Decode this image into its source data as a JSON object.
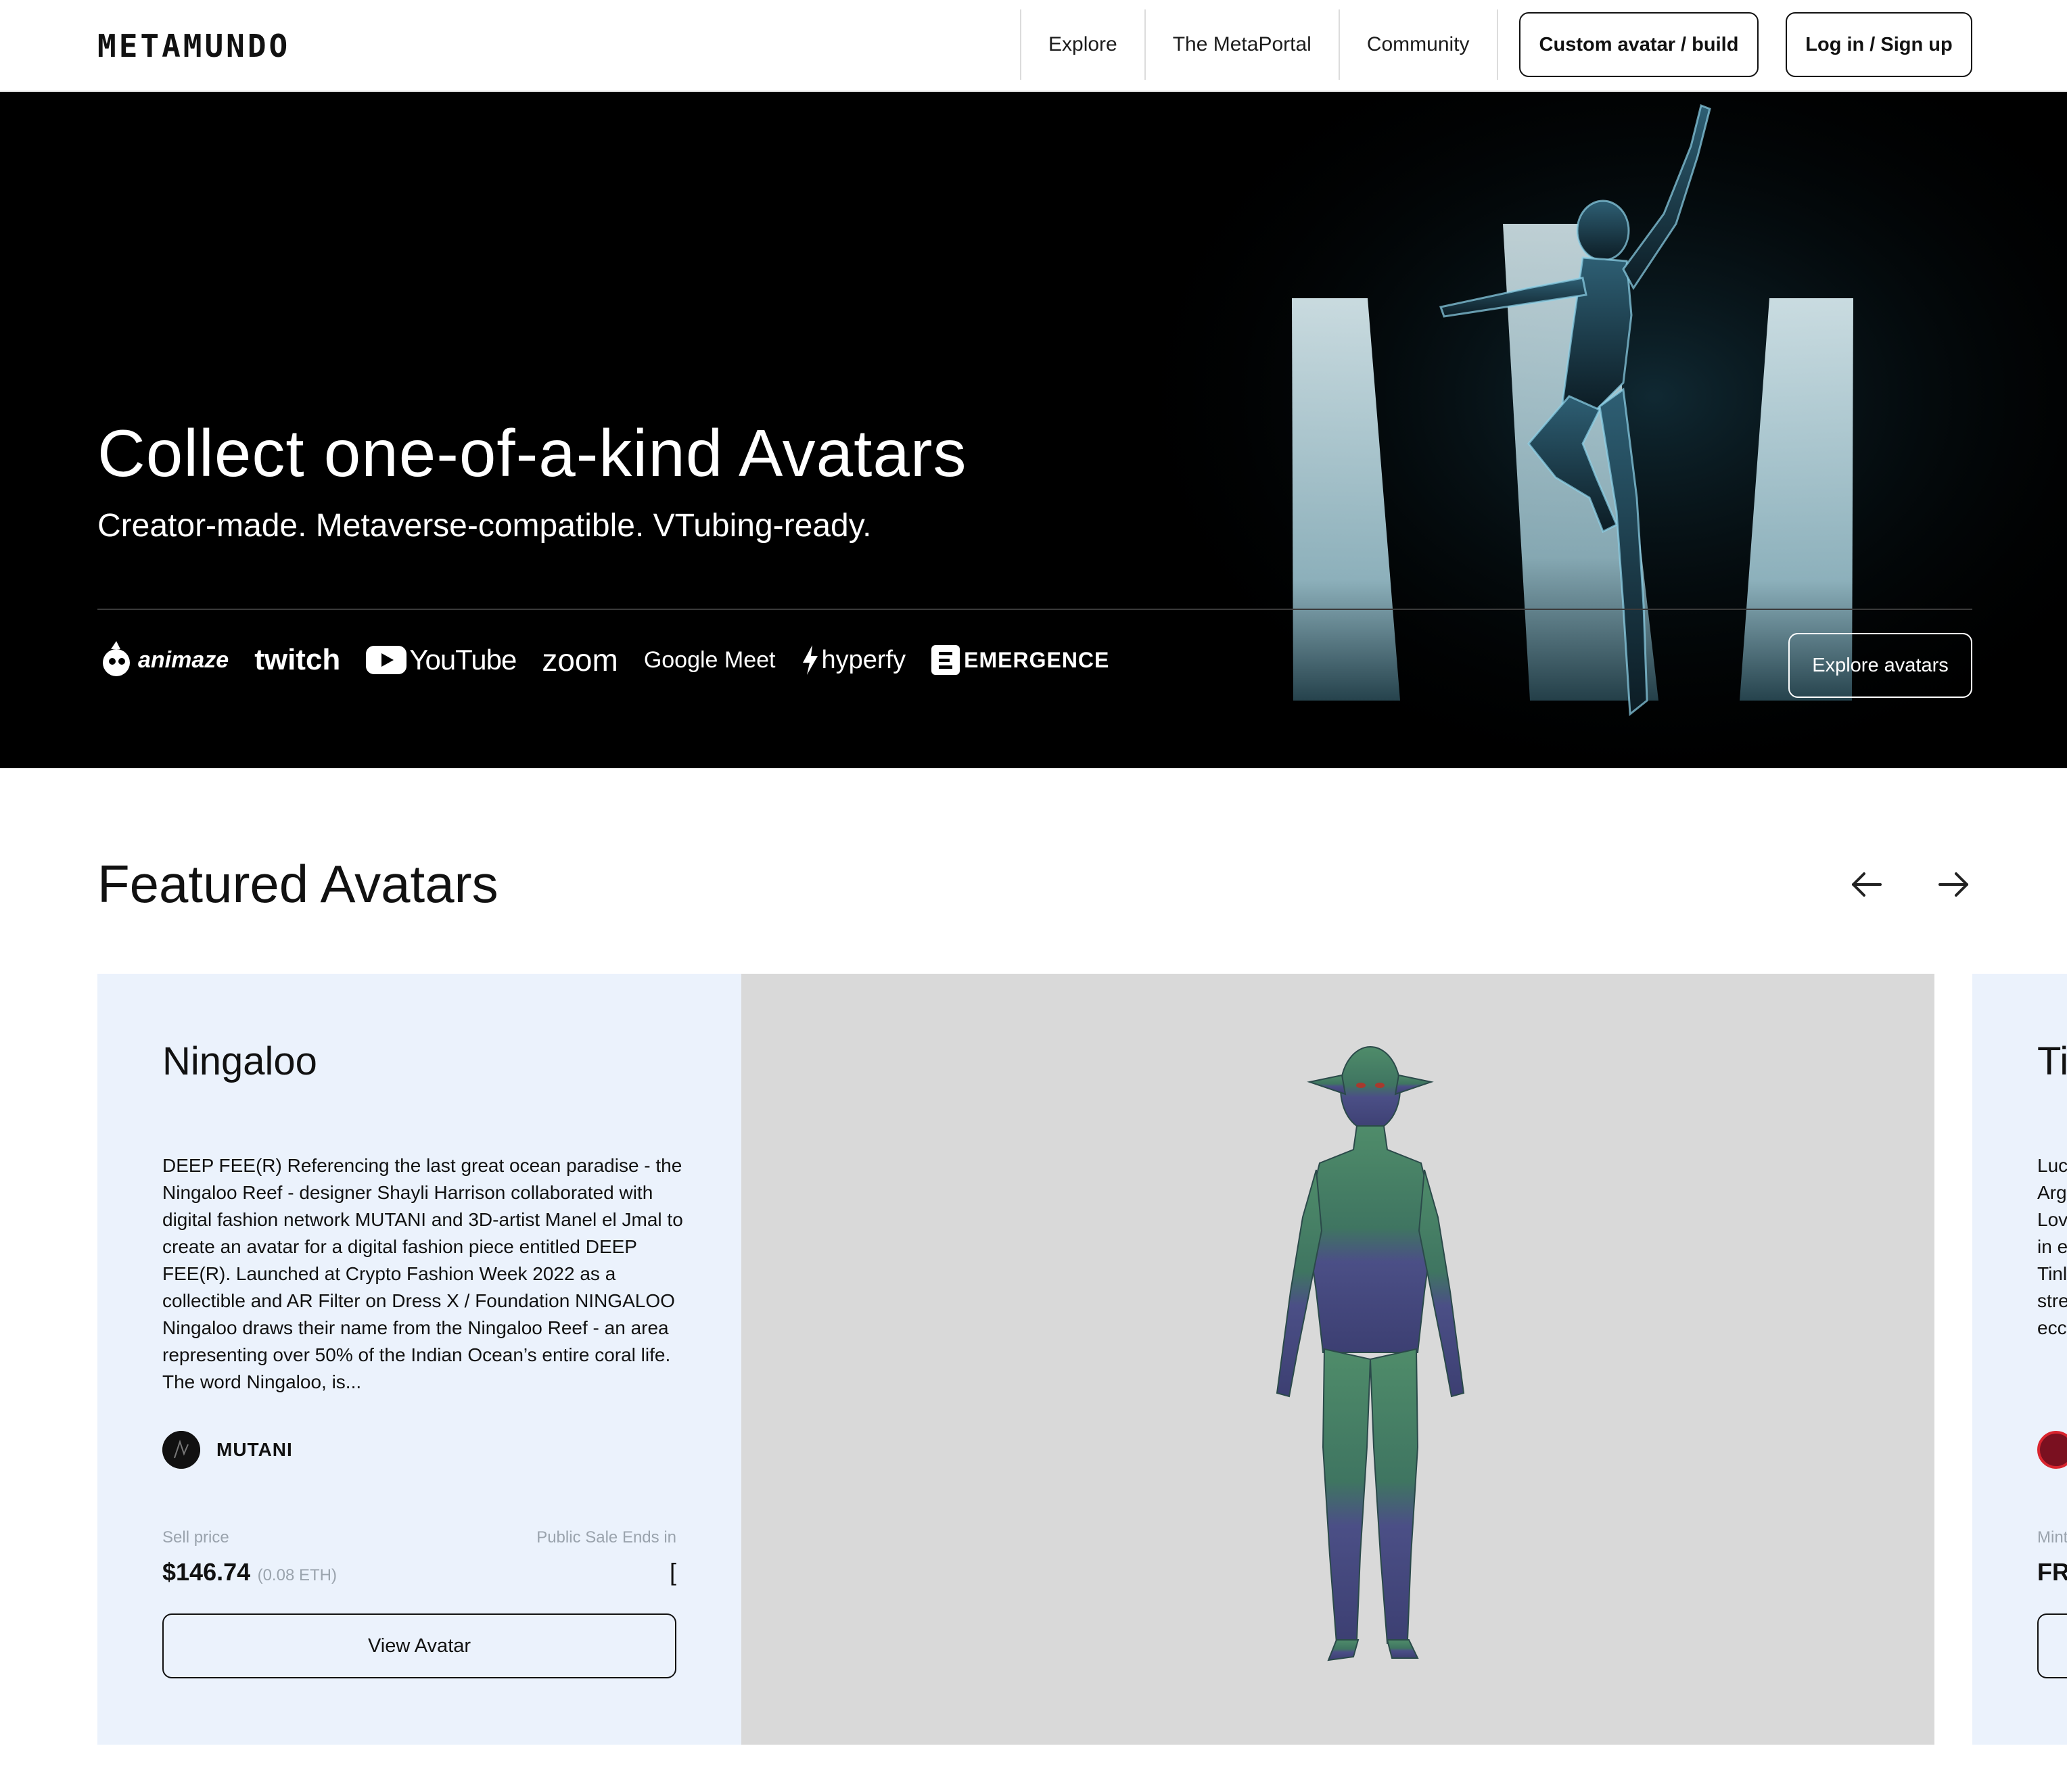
{
  "nav": {
    "logo": "METAMUNDO",
    "links": [
      "Explore",
      "The MetaPortal",
      "Community"
    ],
    "custom_button": "Custom avatar / build",
    "login_button": "Log in / Sign up"
  },
  "hero": {
    "title": "Collect one-of-a-kind Avatars",
    "subtitle": "Creator-made. Metaverse-compatible. VTubing-ready.",
    "brands": [
      "animaze",
      "twitch",
      "YouTube",
      "zoom",
      "Google Meet",
      "hyperfy",
      "EMERGENCE"
    ],
    "cta": "Explore avatars"
  },
  "featured": {
    "title": "Featured Avatars",
    "prev_icon": "arrow-left-icon",
    "next_icon": "arrow-right-icon",
    "card": {
      "name": "Ningaloo",
      "description": "DEEP FEE(R) Referencing the last great ocean paradise - the Ningaloo Reef - designer Shayli Harrison collaborated with digital fashion network MUTANI and 3D-artist Manel el Jmal to create an avatar for a digital fashion piece entitled DEEP FEE(R). Launched at Crypto Fashion Week 2022 as a collectible and AR Filter on Dress X / Foundation NINGALOO Ningaloo draws their name from the Ningaloo Reef - an area representing over 50% of the Indian Ocean’s entire coral life. The word Ningaloo, is...",
      "creator": "MUTANI",
      "sell_price_label": "Sell price",
      "sale_ends_label": "Public Sale Ends in",
      "price_usd": "$146.74",
      "price_eth": "(0.08 ETH)",
      "sale_ends_value": "[",
      "view_button": "View Avatar"
    },
    "next_card": {
      "name": "Ti",
      "description_fragments": [
        "Luc",
        "Arg",
        "Lov",
        "in e",
        "Tinl",
        "stre",
        "ecc"
      ],
      "label": "Mint",
      "price": "FR"
    }
  },
  "colors": {
    "card_bg": "#ebf2fc",
    "media_bg": "#d9d9d9",
    "hero_bg": "#000000",
    "muted_text": "#9aa3ad"
  }
}
